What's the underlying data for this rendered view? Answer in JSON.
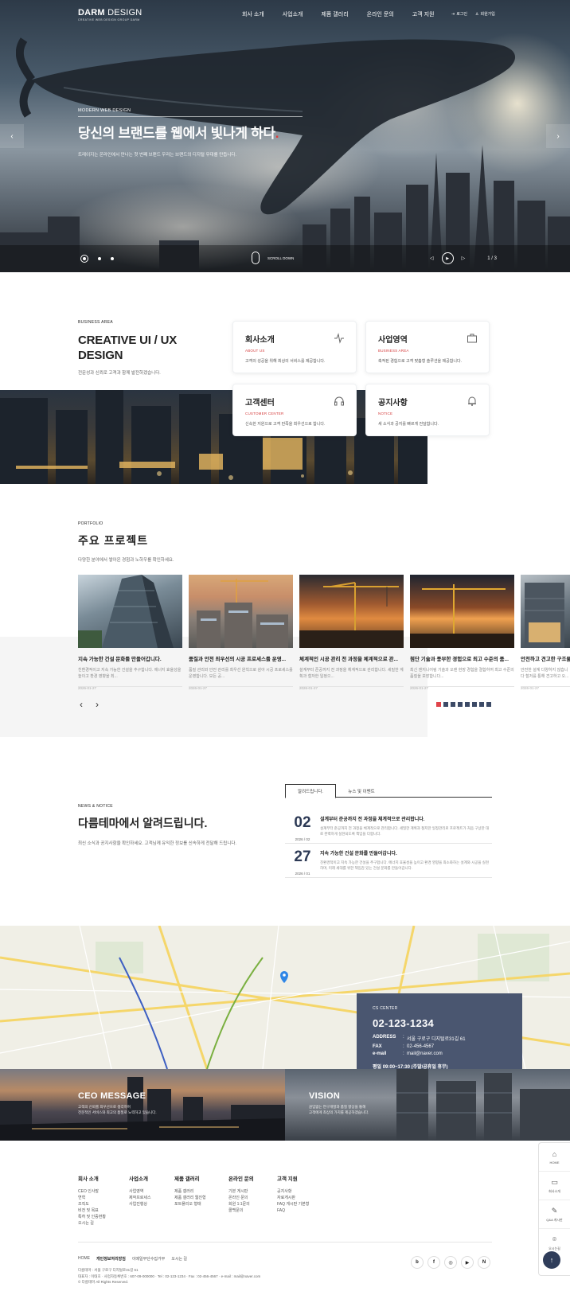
{
  "header": {
    "logo_main": "DARM",
    "logo_main2": "DESIGN",
    "logo_sub": "CREATIVE WEB DESIGN GROUP DARM",
    "nav": [
      "회사 소개",
      "사업소개",
      "제품 갤러리",
      "온라인 문의",
      "고객 지원"
    ],
    "util": {
      "login": "로그인",
      "join": "회원가입"
    }
  },
  "hero": {
    "eyebrow": "MODERN WEB DESIGN",
    "title": "당신의 브랜드를 웹에서 빛나게 하다",
    "title_dot": ".",
    "desc": "트레이지는 온라인에서 만나는 첫 번째 브랜드 우리는 브랜드의 디지털 무대를 만듭니다.",
    "scroll": "SCROLL DOWN",
    "counter": "1 / 3"
  },
  "business": {
    "eyebrow": "BUSINESS AREA",
    "title_line1": "CREATIVE UI / UX",
    "title_line2": "DESIGN",
    "desc": "전문성과 신뢰로 고객과 함께 발전하겠습니다.",
    "cards": [
      {
        "title": "회사소개",
        "en": "ABOUT US",
        "desc": "고객의 성공을 위해 최상의 서비스를 제공합니다.",
        "icon": "pulse-icon"
      },
      {
        "title": "사업영역",
        "en": "BUSINESS AREA",
        "desc": "축적된 경험으로 고객 맞춤형 솔루션을 제공합니다.",
        "icon": "briefcase-icon"
      },
      {
        "title": "고객센터",
        "en": "CUSTOMER CENTER",
        "desc": "신속한 지원으로 고객 만족을 최우선으로 합니다.",
        "icon": "headset-icon"
      },
      {
        "title": "공지사항",
        "en": "NOTICE",
        "desc": "새 소식과 공지를 빠르게 전달합니다.",
        "icon": "bell-icon"
      }
    ]
  },
  "portfolio": {
    "eyebrow": "PORTFOLIO",
    "title": "주요 프로젝트",
    "desc": "다양한 분야에서 쌓아온 경험과 노하우를 확인하세요.",
    "items": [
      {
        "title": "지속 가능한 건설 문화를 만들어갑니다.",
        "desc": "친환경적이고 지속 가능한 건설을 추구합니다. 에너지 효율성을 높이고 환경 영향을 최...",
        "date": "2026-01-27"
      },
      {
        "title": "품질과 안전 최우선의 시공 프로세스를 운영...",
        "desc": "품질 관리와 안전 관리를 최우선 원칙으로 삼아 시공 프로세스를 운영합니다. 모든 공...",
        "date": "2026-01-27"
      },
      {
        "title": "체계적인 시공 관리 전 과정을 체계적으로 관...",
        "desc": "설계부터 준공까지 전 과정을 체계적으로 관리합니다. 세밀한 계획과 철저한 일정으...",
        "date": "2026-01-27"
      },
      {
        "title": "첨단 기술과 풍부한 경험으로 최고 수준의 품...",
        "desc": "최신 엔지니어링 기술과 오랜 현장 경험을 결합하여 최고 수준의 품질을 보장합니다...",
        "date": "2026-01-27"
      },
      {
        "title": "안전하고 견고한 구조물...",
        "desc": "안전한 설계 다양하지 않습니다 철저를 통해 견고하고 오...",
        "date": "2026-01-27"
      }
    ],
    "pager_count": 8,
    "pager_active": 0
  },
  "news": {
    "eyebrow": "NEWS & NOTICE",
    "title": "다름테마에서 알려드립니다.",
    "desc": "최신 소식과 공지사항을 확인하세요. 고객님께 유익한 정보를 신속하게 전달해 드립니다.",
    "tabs": [
      "알려드립니다.",
      "뉴스 및 이벤트"
    ],
    "items": [
      {
        "day": "02",
        "ym": "2026 / 02",
        "title": "설계부터 준공까지 전 과정을 체계적으로 관리합니다.",
        "desc": "설계부터 준공까지 전 과정을 체계적으로 관리합니다. 세밀한 계획과 철저한 일정관리로 프로젝트가 처음 구상한 대로 완벽하게 실현되도록 책임을 다합니다."
      },
      {
        "day": "27",
        "ym": "2026 / 01",
        "title": "지속 가능한 건설 문화를 만들어갑니다.",
        "desc": "친환경적이고 지속 가능한 건설을 추구합니다. 에너지 효율성을 높이고 환경 영향을 최소화하는 설계와 시공을 실천하며, 미래 세대를 위한 책임감 있는 건설 문화를 만들어갑니다."
      }
    ]
  },
  "cs": {
    "label": "CS CENTER",
    "tel": "02-123-1234",
    "rows": [
      {
        "k": "ADDRESS",
        "v": "서울 구로구 디지털로31길 61"
      },
      {
        "k": "FAX",
        "v": "02-456-4567"
      },
      {
        "k": "e-mail",
        "v": "mail@naver.com"
      }
    ],
    "hours": "평일 09:00~17:30 (주말/공휴일 휴무)"
  },
  "ceo": {
    "title": "CEO MESSAGE",
    "desc1": "고객의 신뢰를 최우선으로 생각하며",
    "desc2": "전문적인 서비스와 최고의 품질로 노력하고 있습니다."
  },
  "vision": {
    "title": "VISION",
    "desc1": "끊임없는 연구개발과 품질 향상을 통해",
    "desc2": "고객에게 최상의 가치를 제공하겠습니다."
  },
  "footer": {
    "cols": [
      {
        "h": "회사 소개",
        "items": [
          "CEO 인사말",
          "연혁",
          "조직도",
          "비전 및 목표",
          "특허 및 인증현황",
          "오시는 길"
        ]
      },
      {
        "h": "사업소개",
        "items": [
          "사업영역",
          "제작프로세스",
          "사업진행상"
        ]
      },
      {
        "h": "제품 갤러리",
        "items": [
          "제품 갤러리",
          "제품 갤러리 웹진형",
          "포트폴리오 형태"
        ]
      },
      {
        "h": "온라인 문의",
        "items": [
          "기본 게시판",
          "온라인 문의",
          "회원 1:1문의",
          "콜백문의"
        ]
      },
      {
        "h": "고객 지원",
        "items": [
          "공지사항",
          "자료게시판",
          "FAQ 게시판 기본형",
          "FAQ"
        ]
      }
    ],
    "links": [
      "HOME",
      "개인정보처리방침",
      "이메일무단수집거부",
      "오시는 길"
    ],
    "info1": "다름테마 : 서울 구로구 디지털로31길 61",
    "info2": "대표자 : 이태호 · 사업자등록번호 : 607-09-000000 · Tel : 02-123-1234 · Fax : 02-456-4567 · e-mail : mail@naver.com",
    "copy": "© 다름테마 All Rights Reserved.",
    "social": [
      "blog-icon",
      "facebook-icon",
      "instagram-icon",
      "youtube-icon",
      "naver-icon"
    ],
    "social_text": [
      "b",
      "f",
      "◎",
      "▶",
      "N"
    ]
  },
  "quick": {
    "items": [
      "HOME",
      "회사소개",
      "Q&A 게시판",
      "오시는길"
    ],
    "top": "↑"
  },
  "colors": {
    "accent": "#e03b3b",
    "navy": "#2d3a55",
    "cs_panel": "#4a5670"
  }
}
